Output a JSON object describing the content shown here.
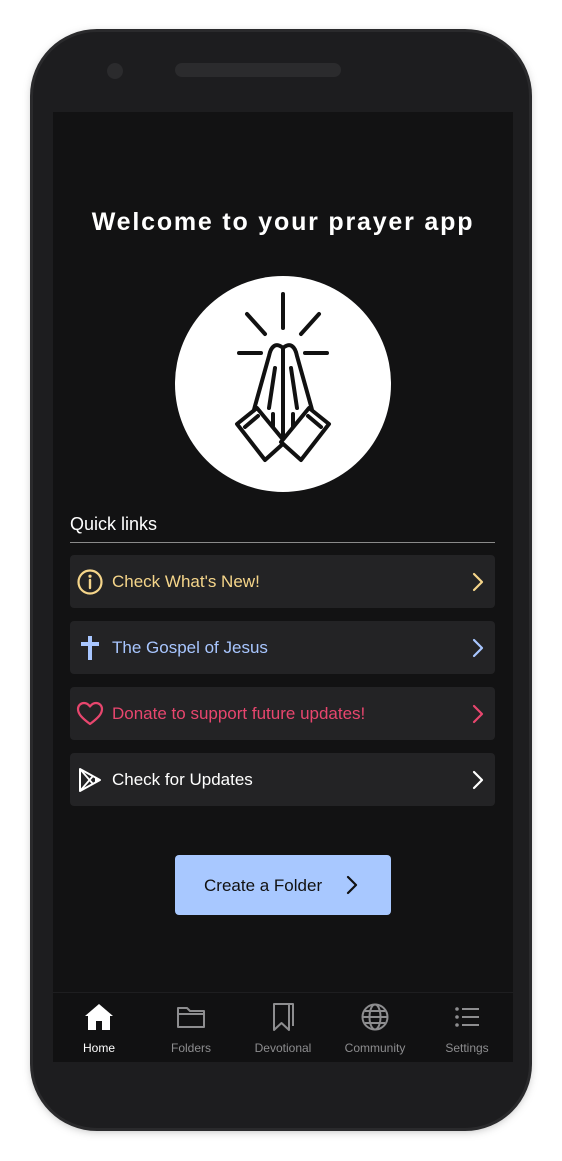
{
  "header": {
    "title": "Welcome to your prayer app"
  },
  "logo": {
    "icon": "praying-hands-icon"
  },
  "quick_links": {
    "label": "Quick links",
    "items": [
      {
        "label": "Check What's New!",
        "icon": "info-icon",
        "color": "#f5d58a"
      },
      {
        "label": "The Gospel of Jesus",
        "icon": "cross-icon",
        "color": "#a8c6ff"
      },
      {
        "label": "Donate to support future updates!",
        "icon": "heart-icon",
        "color": "#e8466e"
      },
      {
        "label": "Check for Updates",
        "icon": "play-store-icon",
        "color": "#ffffff"
      }
    ]
  },
  "create_folder": {
    "label": "Create a Folder",
    "bg": "#a8c8ff"
  },
  "bottom_nav": {
    "items": [
      {
        "label": "Home",
        "icon": "home-icon",
        "active": true
      },
      {
        "label": "Folders",
        "icon": "folder-icon",
        "active": false
      },
      {
        "label": "Devotional",
        "icon": "bookmark-icon",
        "active": false
      },
      {
        "label": "Community",
        "icon": "globe-icon",
        "active": false
      },
      {
        "label": "Settings",
        "icon": "list-icon",
        "active": false
      }
    ]
  },
  "colors": {
    "background": "#121213",
    "card": "#232325",
    "accent": "#a8c8ff"
  }
}
